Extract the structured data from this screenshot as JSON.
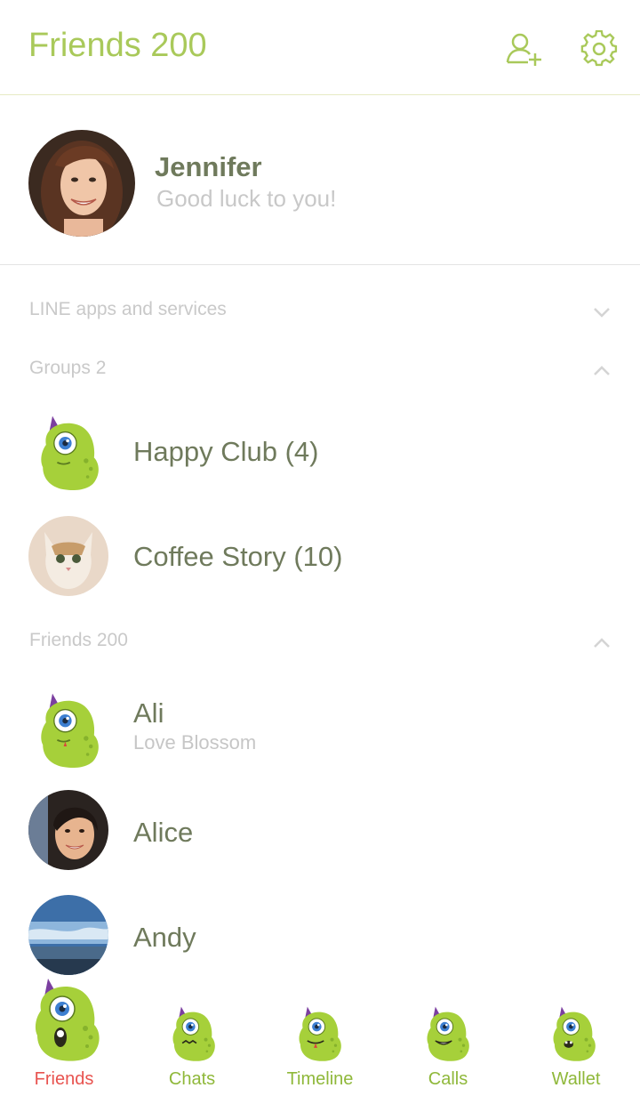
{
  "header": {
    "title": "Friends 200",
    "add_friend_icon": "add-friend-icon",
    "settings_icon": "gear-icon"
  },
  "profile": {
    "name": "Jennifer",
    "status": "Good luck to you!"
  },
  "sections": {
    "apps": {
      "label": "LINE apps and services",
      "expanded": false
    },
    "groups": {
      "label": "Groups 2",
      "expanded": true
    },
    "friends": {
      "label": "Friends 200",
      "expanded": true
    }
  },
  "groups": [
    {
      "name": "Happy Club (4)",
      "avatar": "monster-avatar"
    },
    {
      "name": "Coffee Story (10)",
      "avatar": "cat-photo"
    }
  ],
  "friends": [
    {
      "name": "Ali",
      "status": "Love Blossom",
      "avatar": "monster-avatar"
    },
    {
      "name": "Alice",
      "status": "",
      "avatar": "woman-photo"
    },
    {
      "name": "Andy",
      "status": "",
      "avatar": "sky-photo"
    }
  ],
  "tabs": [
    {
      "label": "Friends",
      "active": true
    },
    {
      "label": "Chats",
      "active": false
    },
    {
      "label": "Timeline",
      "active": false
    },
    {
      "label": "Calls",
      "active": false
    },
    {
      "label": "Wallet",
      "active": false
    }
  ],
  "colors": {
    "accent": "#a9c95a",
    "active_tab": "#e8534f",
    "text": "#6f7a5c",
    "muted": "#c9c9c9",
    "monster_green": "#a6d03a"
  }
}
